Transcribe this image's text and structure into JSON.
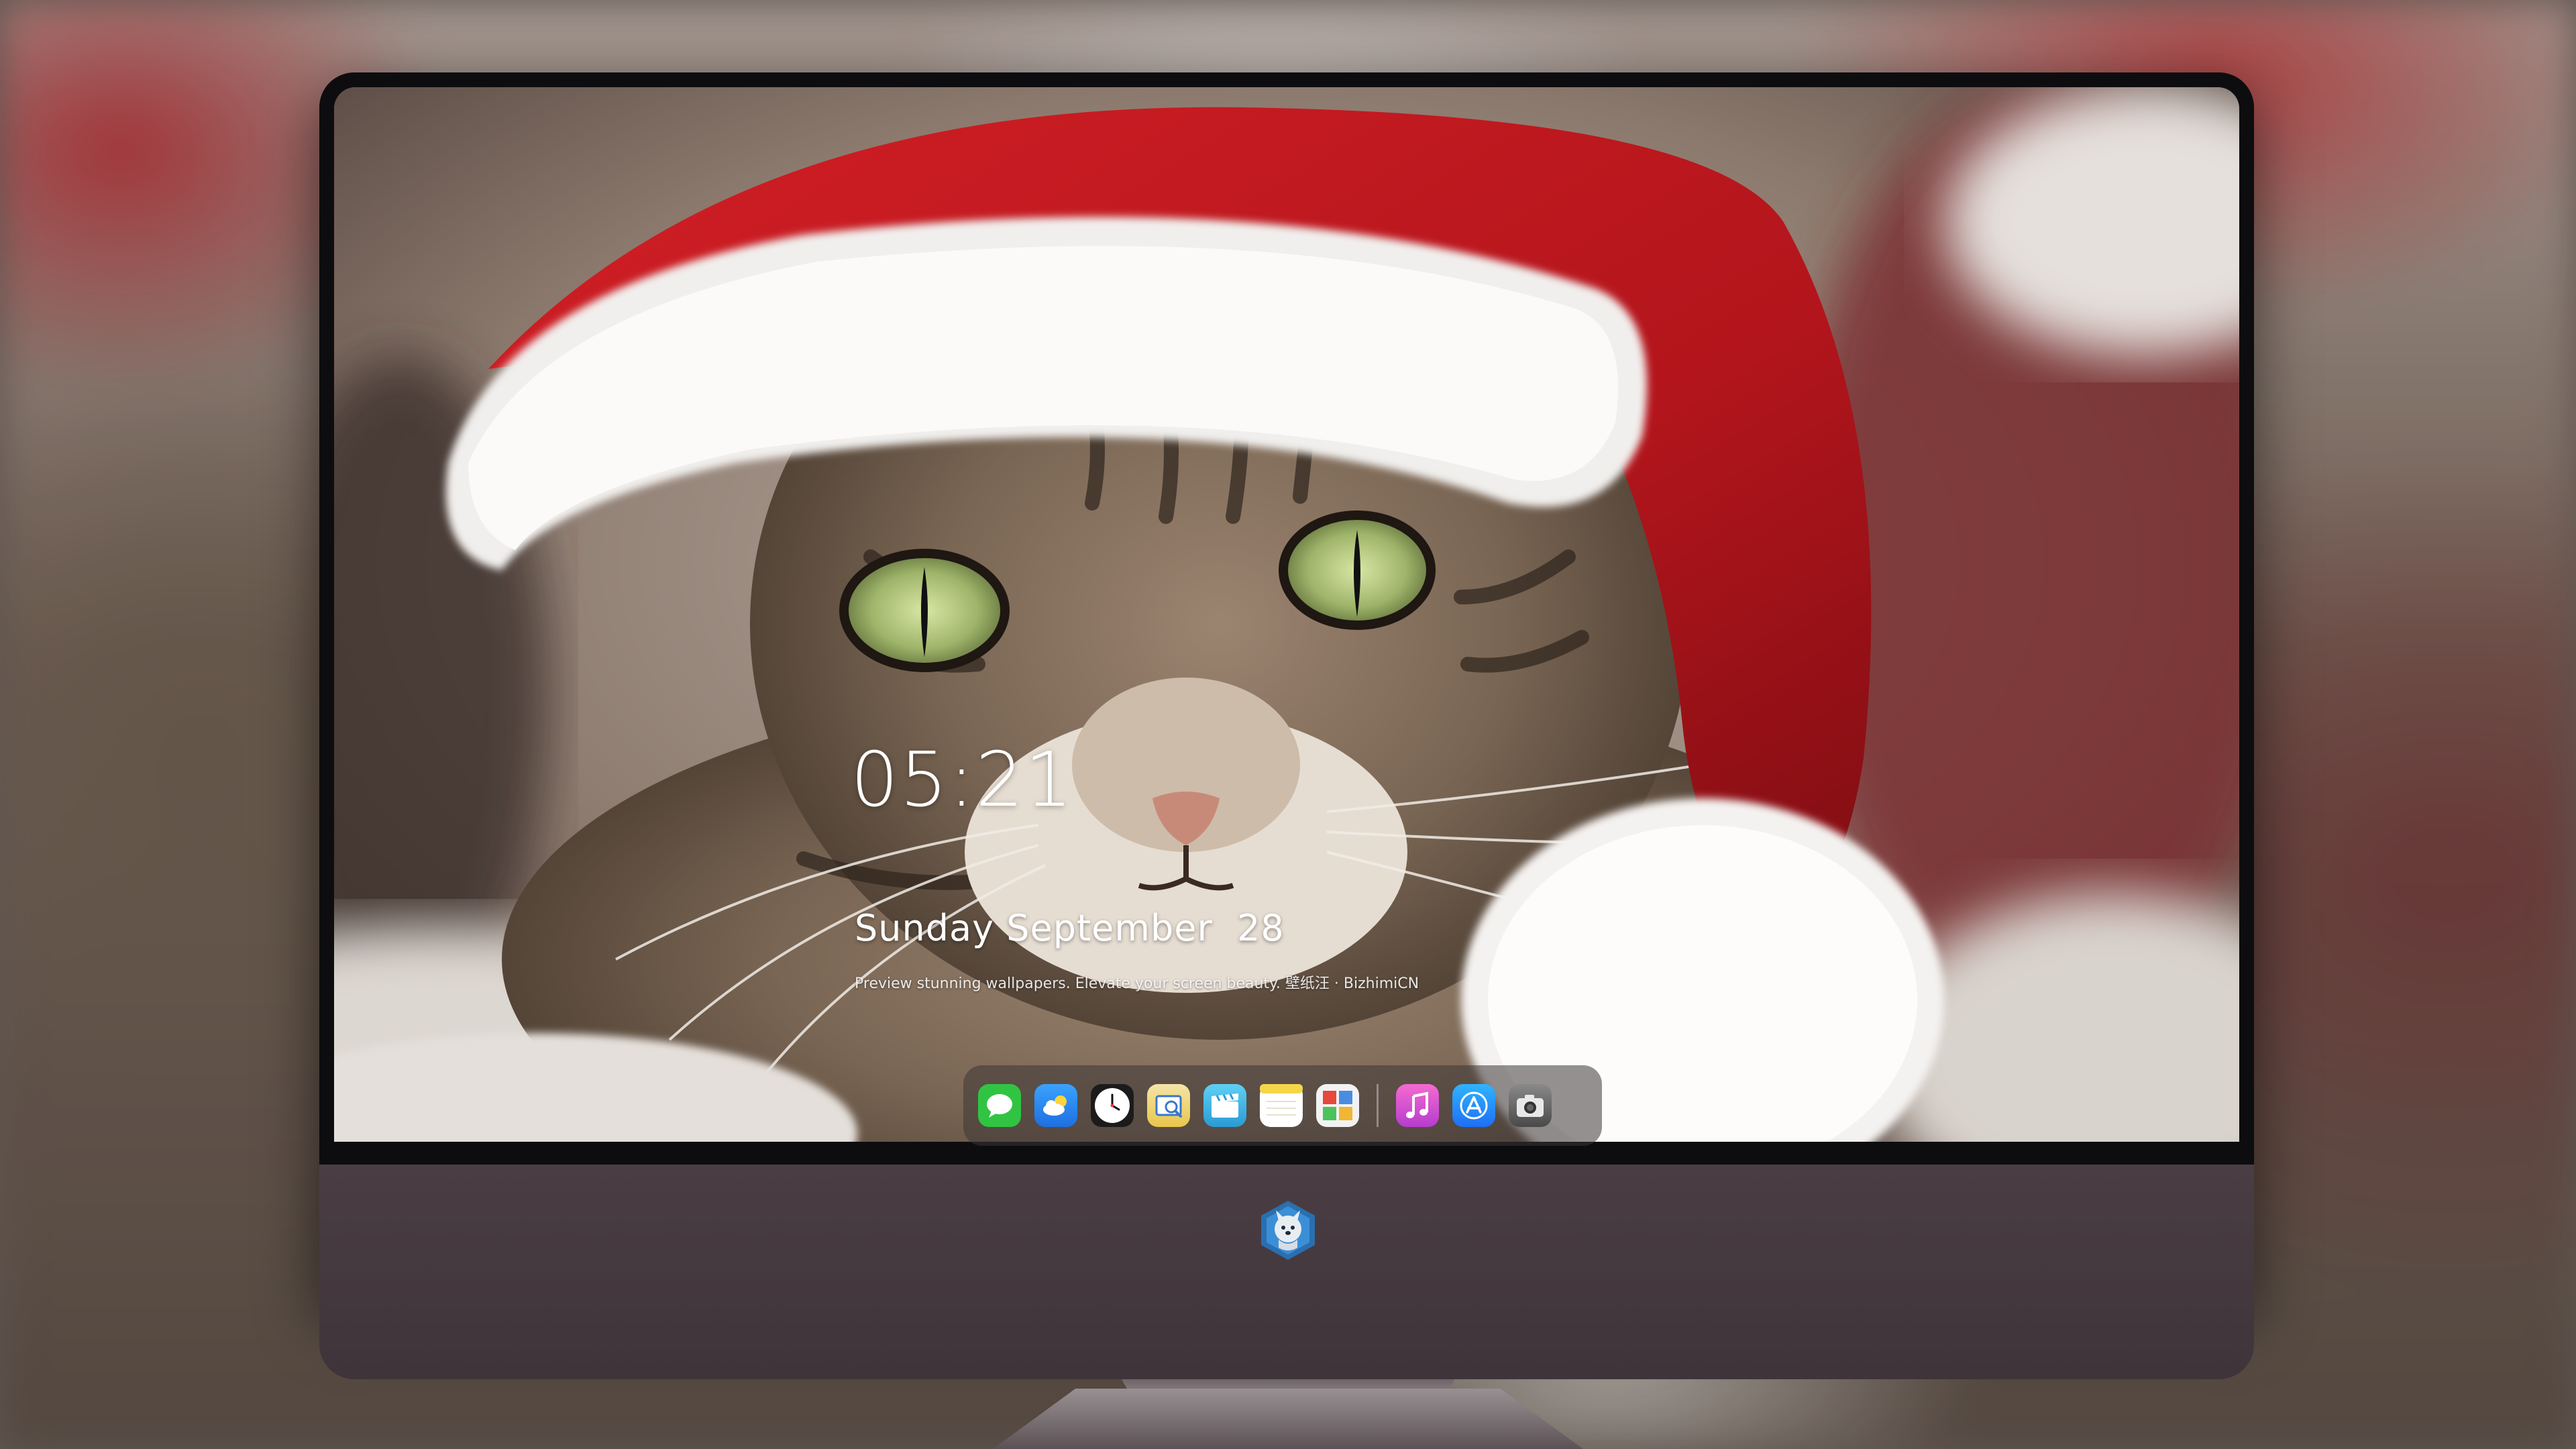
{
  "lockscreen": {
    "time": "05:21",
    "date": "Sunday September  28",
    "tagline": "Preview stunning wallpapers. Elevate your screen beauty. 壁纸汪 · BizhimiCN"
  },
  "dock": {
    "apps": [
      {
        "icon": "messages-icon",
        "color": "#31c443"
      },
      {
        "icon": "weather-icon",
        "color": "#2d8cf0"
      },
      {
        "icon": "clock-icon",
        "color": "#1b1b1b"
      },
      {
        "icon": "preview-icon",
        "color": "#e9c64a"
      },
      {
        "icon": "clips-icon",
        "color": "#3fb6e6"
      },
      {
        "icon": "notes-icon",
        "color": "#f5d64a"
      },
      {
        "icon": "photo-booth-icon",
        "color": "#4a8de0"
      },
      {
        "icon": "music-icon",
        "color": "#e0459a"
      },
      {
        "icon": "app-store-icon",
        "color": "#1e8ef5"
      },
      {
        "icon": "camera-icon",
        "color": "#707070"
      }
    ]
  },
  "monitor": {
    "brand_logo": "husky-logo-icon"
  }
}
